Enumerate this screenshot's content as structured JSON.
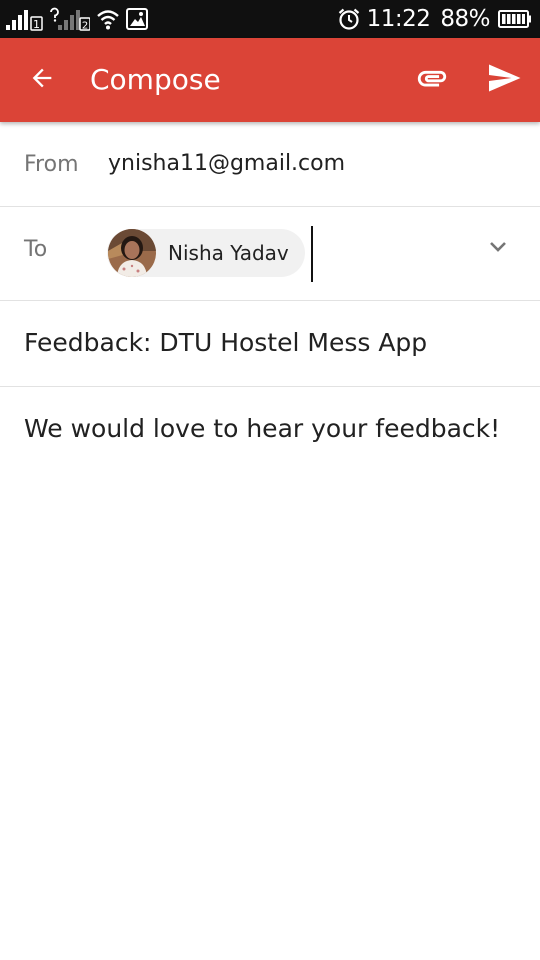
{
  "status_bar": {
    "time": "11:22",
    "battery_percent": "88%",
    "sim1_badge": "1",
    "sim2_badge": "2",
    "icons": [
      "signal-sim1-icon",
      "signal-sim2-icon",
      "wifi-icon",
      "gallery-notification-icon",
      "alarm-icon",
      "battery-icon"
    ]
  },
  "app_bar": {
    "title": "Compose",
    "color": "#db4437",
    "icons": [
      "back-arrow-icon",
      "attachment-icon",
      "send-icon"
    ]
  },
  "compose": {
    "from_label": "From",
    "from_value": "ynisha11@gmail.com",
    "to_label": "To",
    "recipient": {
      "name": "Nisha Yadav",
      "avatar_icon": "contact-avatar"
    },
    "subject": "Feedback: DTU Hostel Mess App",
    "body": "We would love to hear your feedback!"
  }
}
